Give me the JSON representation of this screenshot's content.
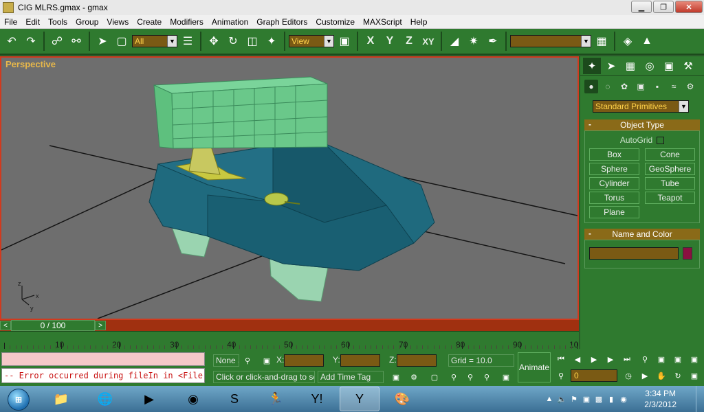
{
  "window": {
    "title": "CIG MLRS.gmax - gmax",
    "min": "▁",
    "max": "❐",
    "close": "✕"
  },
  "menu": [
    "File",
    "Edit",
    "Tools",
    "Group",
    "Views",
    "Create",
    "Modifiers",
    "Animation",
    "Graph Editors",
    "Customize",
    "MAXScript",
    "Help"
  ],
  "toolbar": {
    "selection_filter": "All",
    "ref_coord": "View",
    "axis_x": "X",
    "axis_y": "Y",
    "axis_z": "Z",
    "axis_xy": "XY",
    "named_selection": ""
  },
  "viewport": {
    "label": "Perspective",
    "axis_z": "z",
    "axis_x": "x",
    "axis_y": "y"
  },
  "command_panel": {
    "dropdown": "Standard Primitives",
    "object_type": {
      "header": "Object Type",
      "minus": "-",
      "autogrid": "AutoGrid",
      "buttons": [
        "Box",
        "Cone",
        "Sphere",
        "GeoSphere",
        "Cylinder",
        "Tube",
        "Torus",
        "Teapot",
        "Plane"
      ]
    },
    "name_color": {
      "header": "Name and Color",
      "minus": "-",
      "color": "#8a1040"
    }
  },
  "time_slider": {
    "value": "0 / 100",
    "prev": "<",
    "next": ">"
  },
  "trackbar": {
    "ticks": [
      "10",
      "20",
      "30",
      "40",
      "50",
      "60",
      "70",
      "80",
      "90",
      "10"
    ]
  },
  "status": {
    "listener_error": "-- Error occurred during fileIn in <File:C",
    "selection": "None S",
    "x_label": "X:",
    "y_label": "Y:",
    "z_label": "Z:",
    "grid": "Grid = 10.0",
    "prompt": "Click or click-and-drag to selec",
    "add_time_tag": "Add Time Tag",
    "animate": "Animate",
    "frame": "0"
  },
  "taskbar": {
    "time": "3:34 PM",
    "date": "2/3/2012"
  }
}
